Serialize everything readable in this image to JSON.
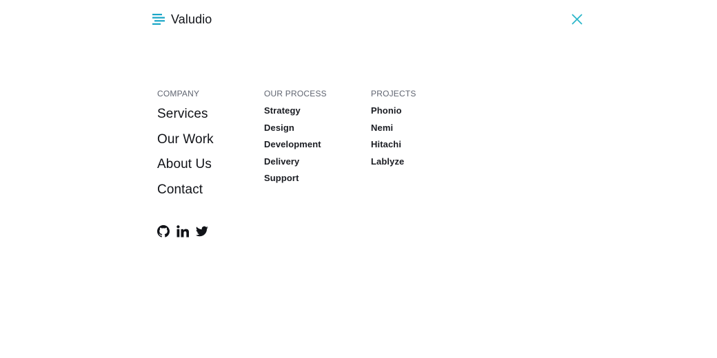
{
  "brand": {
    "name": "Valudio",
    "accent_color": "#1aa6c7"
  },
  "close": {
    "icon": "close-icon",
    "color": "#2bb6c9"
  },
  "company": {
    "heading": "COMPANY",
    "items": [
      {
        "label": "Services"
      },
      {
        "label": "Our Work"
      },
      {
        "label": "About Us"
      },
      {
        "label": "Contact"
      }
    ]
  },
  "process": {
    "heading": "OUR PROCESS",
    "items": [
      {
        "label": "Strategy"
      },
      {
        "label": "Design"
      },
      {
        "label": "Development"
      },
      {
        "label": "Delivery"
      },
      {
        "label": "Support"
      }
    ]
  },
  "projects": {
    "heading": "PROJECTS",
    "items": [
      {
        "label": "Phonio"
      },
      {
        "label": "Nemi"
      },
      {
        "label": "Hitachi"
      },
      {
        "label": "Lablyze"
      }
    ]
  },
  "social": {
    "items": [
      {
        "icon": "github-icon"
      },
      {
        "icon": "linkedin-icon"
      },
      {
        "icon": "twitter-icon"
      }
    ]
  }
}
